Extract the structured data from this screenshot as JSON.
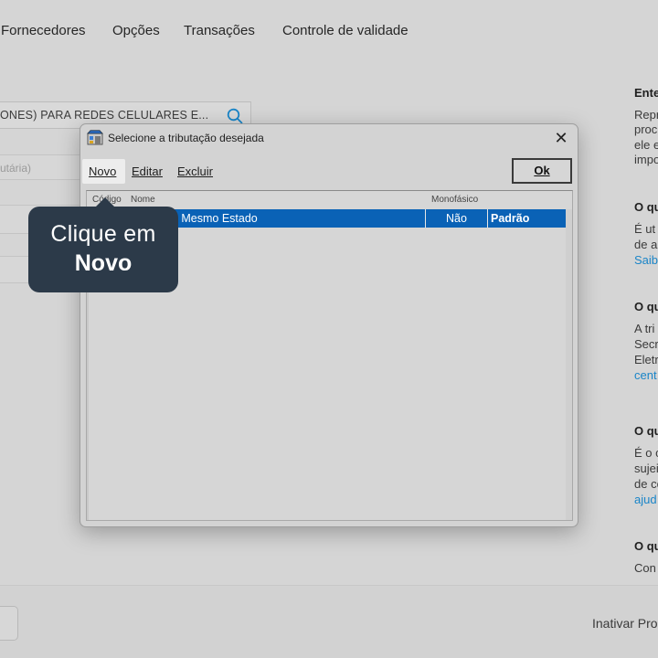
{
  "nav": {
    "items": [
      "Fornecedores",
      "Opções",
      "Transações",
      "Controle de validade"
    ]
  },
  "form": {
    "search_value": "ONES)  PARA REDES CELULARES E...",
    "field_placeholder": "utária)"
  },
  "help_panel": {
    "section1_title": "Ente",
    "section1_lines": [
      "Repr",
      "proc",
      "ele e",
      "impo"
    ],
    "section2_title": "O qu",
    "section2_lines": [
      "É ut",
      "de a"
    ],
    "section2_link": "Saib",
    "section3_title": "O qu",
    "section3_lines": [
      "A tri",
      "Secr",
      "Eletr"
    ],
    "section3_link": "cent",
    "section4_title": "O qu",
    "section4_lines": [
      "É o c",
      "sujei",
      "de co"
    ],
    "section4_link": "ajud",
    "section5_title": "O qu",
    "section5_lines": [
      "Con"
    ]
  },
  "footer": {
    "inativar_label": "Inativar Pro"
  },
  "dialog": {
    "title": "Selecione a tributação desejada",
    "close_symbol": "✕",
    "toolbar": {
      "novo": "Novo",
      "editar": "Editar",
      "excluir": "Excluir",
      "ok": "Ok"
    },
    "grid": {
      "columns": {
        "code": "Código",
        "name": "Nome",
        "mono": "Monofásico"
      },
      "rows": [
        {
          "name": "ão Mesmo Estado",
          "mono": "Não",
          "status": "Padrão"
        }
      ]
    }
  },
  "tooltip": {
    "line1": "Clique em",
    "line2": "Novo"
  },
  "colors": {
    "selection": "#0a62b6",
    "tooltip_bg": "#2c3a49",
    "link": "#1a85c8"
  }
}
